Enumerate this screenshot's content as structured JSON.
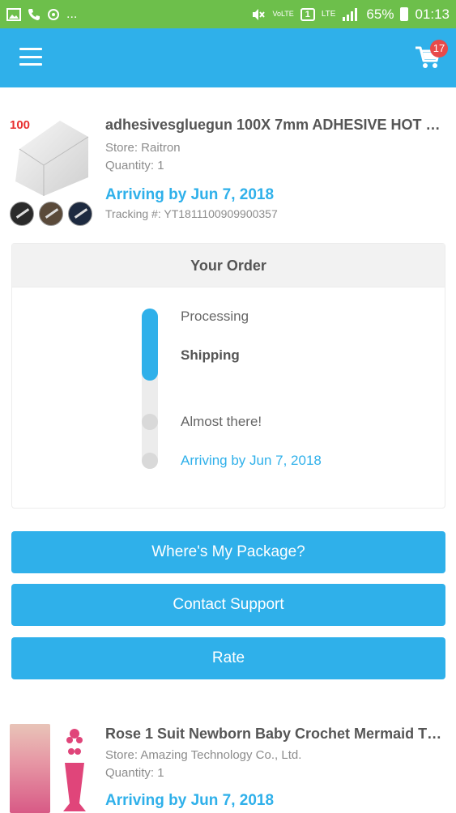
{
  "status_bar": {
    "left_dots": "...",
    "lte_label": "LTE",
    "volte_label": "VoLTE",
    "sim_label": "1",
    "battery": "65%",
    "time": "01:13"
  },
  "app_bar": {
    "cart_count": "17"
  },
  "orders": [
    {
      "thumb_label": "100",
      "title": "adhesivesgluegun 100X 7mm ADHESIVE HOT …",
      "store": "Store: Raitron",
      "quantity": "Quantity: 1",
      "arriving": "Arriving by Jun 7, 2018",
      "tracking": "Tracking #: YT1811100909900357"
    },
    {
      "title": "Rose 1 Suit Newborn Baby Crochet Mermaid T…",
      "store": "Store: Amazing Technology Co., Ltd.",
      "quantity": "Quantity: 1",
      "arriving": "Arriving by Jun 7, 2018"
    }
  ],
  "order_card": {
    "heading": "Your Order",
    "progress": 0.45,
    "steps": [
      "Processing",
      "Shipping",
      "Almost there!",
      "Arriving by Jun 7, 2018"
    ]
  },
  "buttons": {
    "where_package": "Where's My Package?",
    "contact_support": "Contact Support",
    "rate": "Rate"
  },
  "colors": {
    "status_bar": "#6dbf4b",
    "accent": "#2fb0ea",
    "badge": "#e84a4a"
  }
}
